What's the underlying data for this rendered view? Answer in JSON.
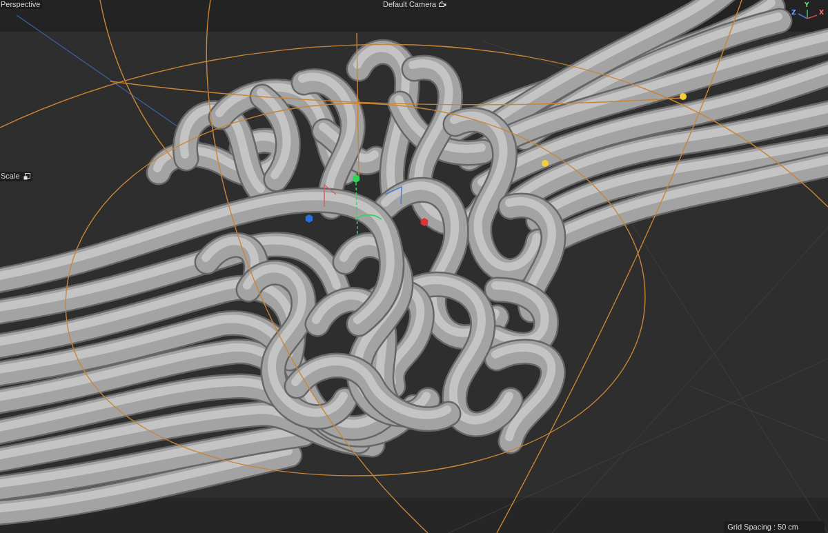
{
  "viewport": {
    "view_label": "Perspective",
    "camera": {
      "label": "Default Camera"
    },
    "tool": {
      "label": "Scale"
    },
    "axis_gizmo": {
      "labels": [
        "Y",
        "Z",
        "X"
      ]
    },
    "grid_spacing": "Grid Spacing : 50 cm"
  }
}
